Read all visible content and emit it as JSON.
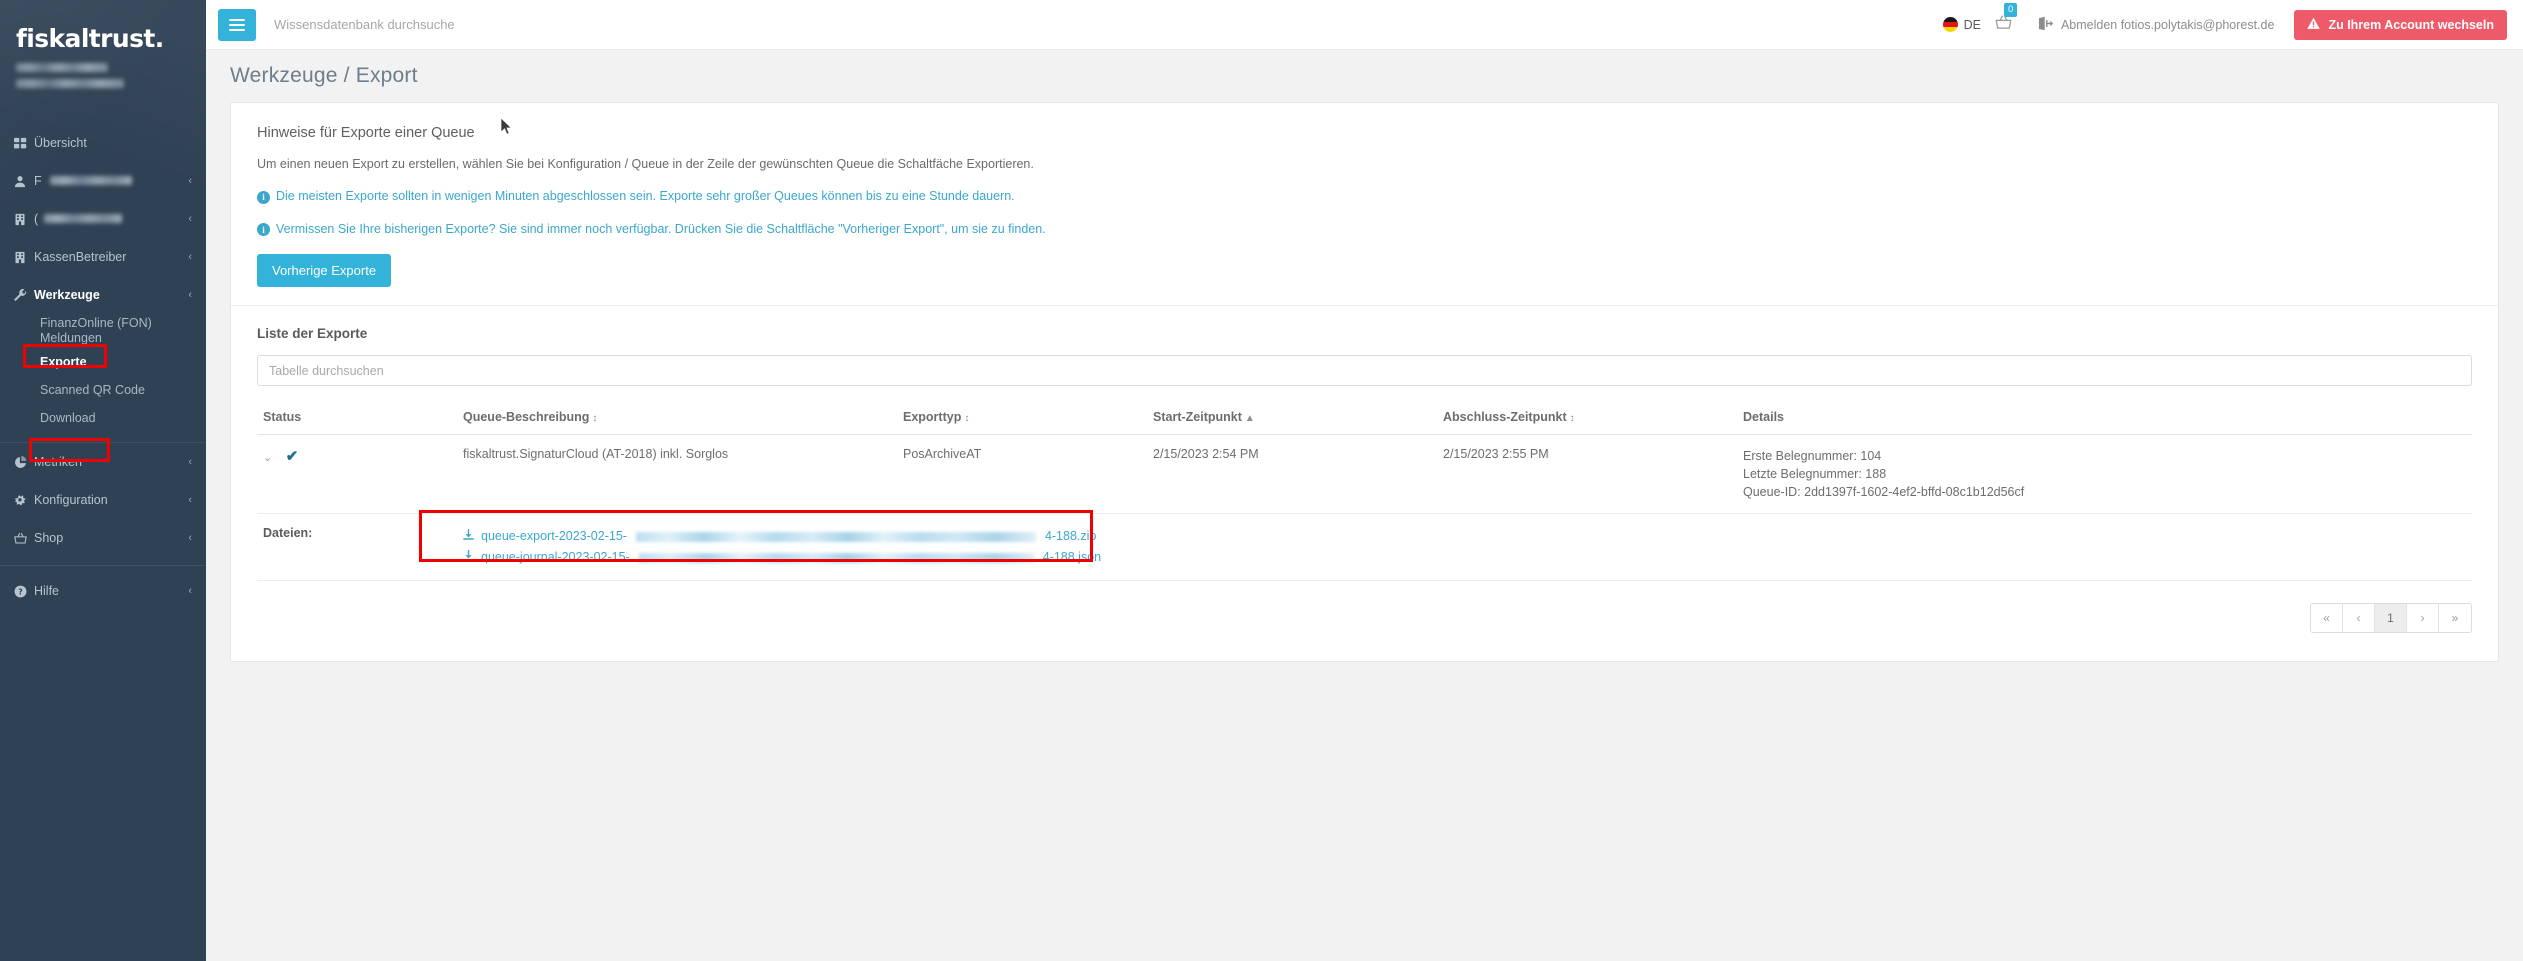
{
  "brand": {
    "logo": "fiskaltrust."
  },
  "sidebar": {
    "items": [
      {
        "label": "Übersicht",
        "icon": "grid-icon",
        "chevron": false,
        "blurred": false
      },
      {
        "label": "F",
        "icon": "user-icon",
        "chevron": true,
        "blurred": true
      },
      {
        "label": "(",
        "icon": "building-icon",
        "chevron": true,
        "blurred": true
      },
      {
        "label": "KassenBetreiber",
        "icon": "building-icon",
        "chevron": true,
        "blurred": false
      },
      {
        "label": "Werkzeuge",
        "icon": "wrench-icon",
        "chevron": true,
        "blurred": false,
        "active": true
      }
    ],
    "subitems": [
      {
        "label": "FinanzOnline (FON) Meldungen",
        "current": false
      },
      {
        "label": "Exporte",
        "current": true
      },
      {
        "label": "Scanned QR Code",
        "current": false
      },
      {
        "label": "Download",
        "current": false
      }
    ],
    "items_lower": [
      {
        "label": "Metriken",
        "icon": "pie-chart-icon",
        "chevron": true
      },
      {
        "label": "Konfiguration",
        "icon": "gears-icon",
        "chevron": true
      },
      {
        "label": "Shop",
        "icon": "basket-icon",
        "chevron": true
      }
    ],
    "items_footer": [
      {
        "label": "Hilfe",
        "icon": "question-circle-icon",
        "chevron": true
      }
    ]
  },
  "topbar": {
    "menu_icon": "hamburger-icon",
    "search_placeholder": "Wissensdatenbank durchsuche",
    "search_value": "",
    "language": "DE",
    "flag_icon": "german-flag-icon",
    "cart_icon": "basket-icon",
    "cart_count": "0",
    "logout_icon": "sign-out-icon",
    "logout_label": "Abmelden fotios.polytakis@phorest.de",
    "account_button_label": "Zu Ihrem Account wechseln",
    "account_button_icon": "warning-triangle-icon",
    "account_button_color": "#ef5a6a"
  },
  "page": {
    "title": "Werkzeuge / Export"
  },
  "hints": {
    "title": "Hinweise für Exporte einer Queue",
    "text": "Um einen neuen Export zu erstellen, wählen Sie bei Konfiguration / Queue in der Zeile der gewünschten Queue die Schaltfäche Exportieren.",
    "info1": "Die meisten Exporte sollten in wenigen Minuten abgeschlossen sein. Exporte sehr großer Queues können bis zu eine Stunde dauern.",
    "info2": "Vermissen Sie Ihre bisherigen Exporte? Sie sind immer noch verfügbar. Drücken Sie die Schaltfläche \"Vorheriger Export\", um sie zu finden.",
    "button_label": "Vorherige Exporte",
    "button_color": "#34b3da",
    "info_color": "#3ba7cd"
  },
  "list": {
    "title": "Liste der Exporte",
    "search_placeholder": "Tabelle durchsuchen",
    "search_value": "",
    "columns": [
      {
        "label": "Status",
        "sort": ""
      },
      {
        "label": "Queue-Beschreibung",
        "sort": "both"
      },
      {
        "label": "Exporttyp",
        "sort": "both"
      },
      {
        "label": "Start-Zeitpunkt",
        "sort": "asc"
      },
      {
        "label": "Abschluss-Zeitpunkt",
        "sort": "both"
      },
      {
        "label": "Details",
        "sort": ""
      }
    ],
    "rows": [
      {
        "status_icon": "checkmark-icon",
        "expand_icon": "chevron-down-icon",
        "queue": "fiskaltrust.SignaturCloud (AT-2018) inkl. Sorglos",
        "type": "PosArchiveAT",
        "start": "2/15/2023 2:54 PM",
        "end": "2/15/2023 2:55 PM",
        "details": [
          "Erste Belegnummer: 104",
          "Letzte Belegnummer: 188",
          "Queue-ID: 2dd1397f-1602-4ef2-bffd-08c1b12d56cf"
        ]
      }
    ],
    "files_label": "Dateien:",
    "files": [
      {
        "prefix": "queue-export-2023-02-15-",
        "suffix": "4-188.zip",
        "icon": "download-icon"
      },
      {
        "prefix": "queue-journal-2023-02-15-",
        "suffix": "4-188.json",
        "icon": "download-icon"
      }
    ],
    "pagination": {
      "first": "«",
      "prev": "‹",
      "current": "1",
      "next": "›",
      "last": "»"
    }
  },
  "annotations": {
    "highlight_color": "#f10000"
  }
}
